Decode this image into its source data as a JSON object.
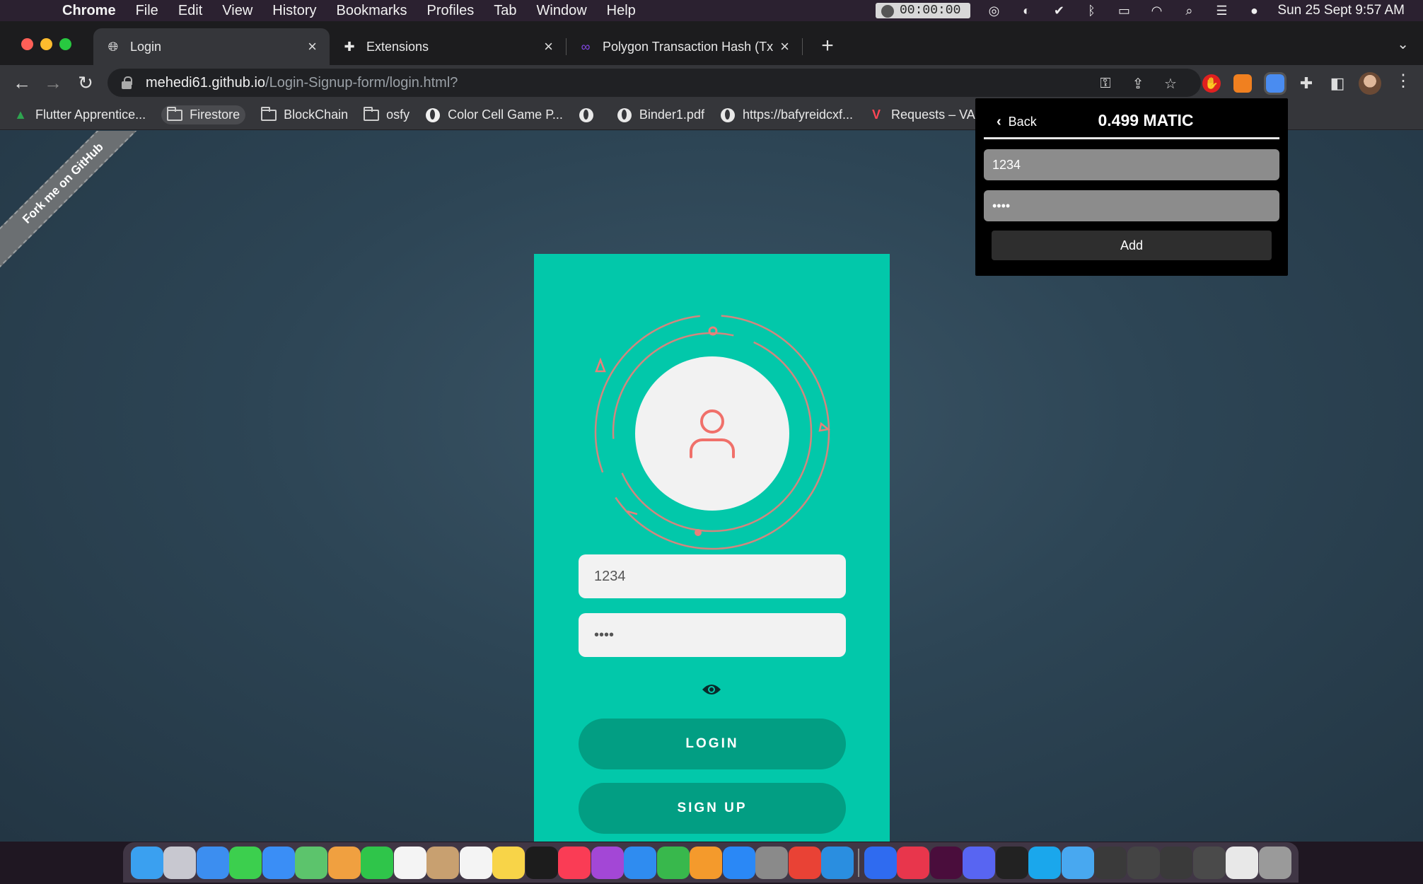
{
  "menubar": {
    "app_name": "Chrome",
    "items": [
      "File",
      "Edit",
      "View",
      "History",
      "Bookmarks",
      "Profiles",
      "Tab",
      "Window",
      "Help"
    ],
    "timer": "00:00:00",
    "datetime": "Sun 25 Sept  9:57 AM"
  },
  "tabs": [
    {
      "label": "Login",
      "icon": "globe-icon"
    },
    {
      "label": "Extensions",
      "icon": "puzzle-icon"
    },
    {
      "label": "Polygon Transaction Hash (Txh",
      "icon": "polygon-icon"
    }
  ],
  "address_bar": {
    "host": "mehedi61.github.io",
    "path": "/Login-Signup-form/login.html?"
  },
  "bookmarks": [
    {
      "label": "Flutter Apprentice...",
      "icon": "flutter-icon"
    },
    {
      "label": "Firestore",
      "icon": "folder-icon"
    },
    {
      "label": "BlockChain",
      "icon": "folder-icon"
    },
    {
      "label": "osfy",
      "icon": "folder-icon"
    },
    {
      "label": "Color Cell Game P...",
      "icon": "github-icon"
    },
    {
      "label": "",
      "icon": "globe-icon"
    },
    {
      "label": "Binder1.pdf",
      "icon": "globe-icon"
    },
    {
      "label": "https://bafyreidcxf...",
      "icon": "globe-icon"
    },
    {
      "label": "Requests – VALC",
      "icon": "valorant-icon"
    }
  ],
  "page": {
    "ribbon_text": "Fork me on GitHub",
    "username_value": "1234",
    "password_value": "••••",
    "login_label": "LOGIN",
    "signup_label": "SIGN UP",
    "accent_color": "#02c8aa",
    "button_color": "#029e83",
    "icon_color": "#f0706a"
  },
  "extension_popup": {
    "back_label": "Back",
    "balance": "0.499 MATIC",
    "field1_value": "1234",
    "field2_value": "••••",
    "add_label": "Add"
  },
  "dock": {
    "apps": [
      {
        "name": "finder-icon",
        "color": "#3aa0f0"
      },
      {
        "name": "launchpad-icon",
        "color": "#c8c8d0"
      },
      {
        "name": "safari-icon",
        "color": "#3c8ef0"
      },
      {
        "name": "messages-icon",
        "color": "#3ccf4e"
      },
      {
        "name": "mail-icon",
        "color": "#3a8ef6"
      },
      {
        "name": "maps-icon",
        "color": "#5cc46c"
      },
      {
        "name": "photos-icon",
        "color": "#f0a040"
      },
      {
        "name": "facetime-icon",
        "color": "#2fc54a"
      },
      {
        "name": "calendar-icon",
        "color": "#f4f4f4"
      },
      {
        "name": "contacts-icon",
        "color": "#c8a070"
      },
      {
        "name": "reminders-icon",
        "color": "#f4f4f4"
      },
      {
        "name": "notes-icon",
        "color": "#f8d448"
      },
      {
        "name": "tv-icon",
        "color": "#1c1c1c"
      },
      {
        "name": "music-icon",
        "color": "#fa3c55"
      },
      {
        "name": "podcasts-icon",
        "color": "#a347d6"
      },
      {
        "name": "keynote-icon",
        "color": "#2f8cf0"
      },
      {
        "name": "numbers-icon",
        "color": "#38b84c"
      },
      {
        "name": "pages-icon",
        "color": "#f49a2c"
      },
      {
        "name": "app-store-icon",
        "color": "#2a88f6"
      },
      {
        "name": "system-preferences-icon",
        "color": "#8a8a8a"
      },
      {
        "name": "chrome-icon",
        "color": "#e94235"
      },
      {
        "name": "vscode-icon",
        "color": "#2a8ee0"
      },
      {
        "name": "cloud-app-icon",
        "color": "#2f6bf0"
      },
      {
        "name": "creative-cloud-icon",
        "color": "#e8364c"
      },
      {
        "name": "xd-icon",
        "color": "#4a0d3c"
      },
      {
        "name": "discord-icon",
        "color": "#5865f2"
      },
      {
        "name": "terminal-icon",
        "color": "#222222"
      },
      {
        "name": "skype-icon",
        "color": "#1aa7ec"
      },
      {
        "name": "files-folder-icon",
        "color": "#48a8f0"
      },
      {
        "name": "window-thumb-icon",
        "color": "#3a3a3a"
      },
      {
        "name": "window-thumb-icon",
        "color": "#444444"
      },
      {
        "name": "window-thumb-icon",
        "color": "#3a3a3a"
      },
      {
        "name": "window-thumb-icon",
        "color": "#4a4a4a"
      },
      {
        "name": "document-icon",
        "color": "#e8e8e8"
      },
      {
        "name": "trash-icon",
        "color": "#9a9a9a"
      }
    ]
  }
}
